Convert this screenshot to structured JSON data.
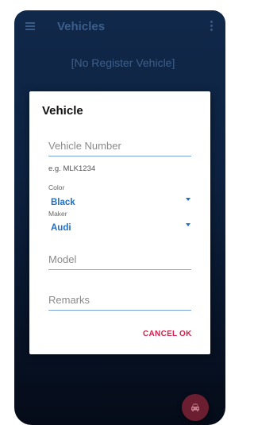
{
  "appbar": {
    "title": "Vehicles",
    "menu_icon": "menu-icon",
    "more_icon": "more-vert-icon"
  },
  "main": {
    "empty_message": "[No Register Vehicle]"
  },
  "dialog": {
    "title": "Vehicle",
    "vehicle_number": {
      "placeholder": "Vehicle Number",
      "value": "",
      "hint": "e.g. MLK1234"
    },
    "color": {
      "label": "Color",
      "selected": "Black"
    },
    "maker": {
      "label": "Maker",
      "selected": "Audi"
    },
    "model": {
      "placeholder": "Model",
      "value": ""
    },
    "remarks": {
      "placeholder": "Remarks",
      "value": ""
    },
    "cancel_label": "CANCEL",
    "ok_label": "OK"
  },
  "fab": {
    "icon": "car-icon"
  },
  "colors": {
    "accent_blue": "#1e6fc8",
    "button_red": "#d11f4a",
    "fab_bg": "#6b1e30",
    "background_top": "#10284a"
  }
}
